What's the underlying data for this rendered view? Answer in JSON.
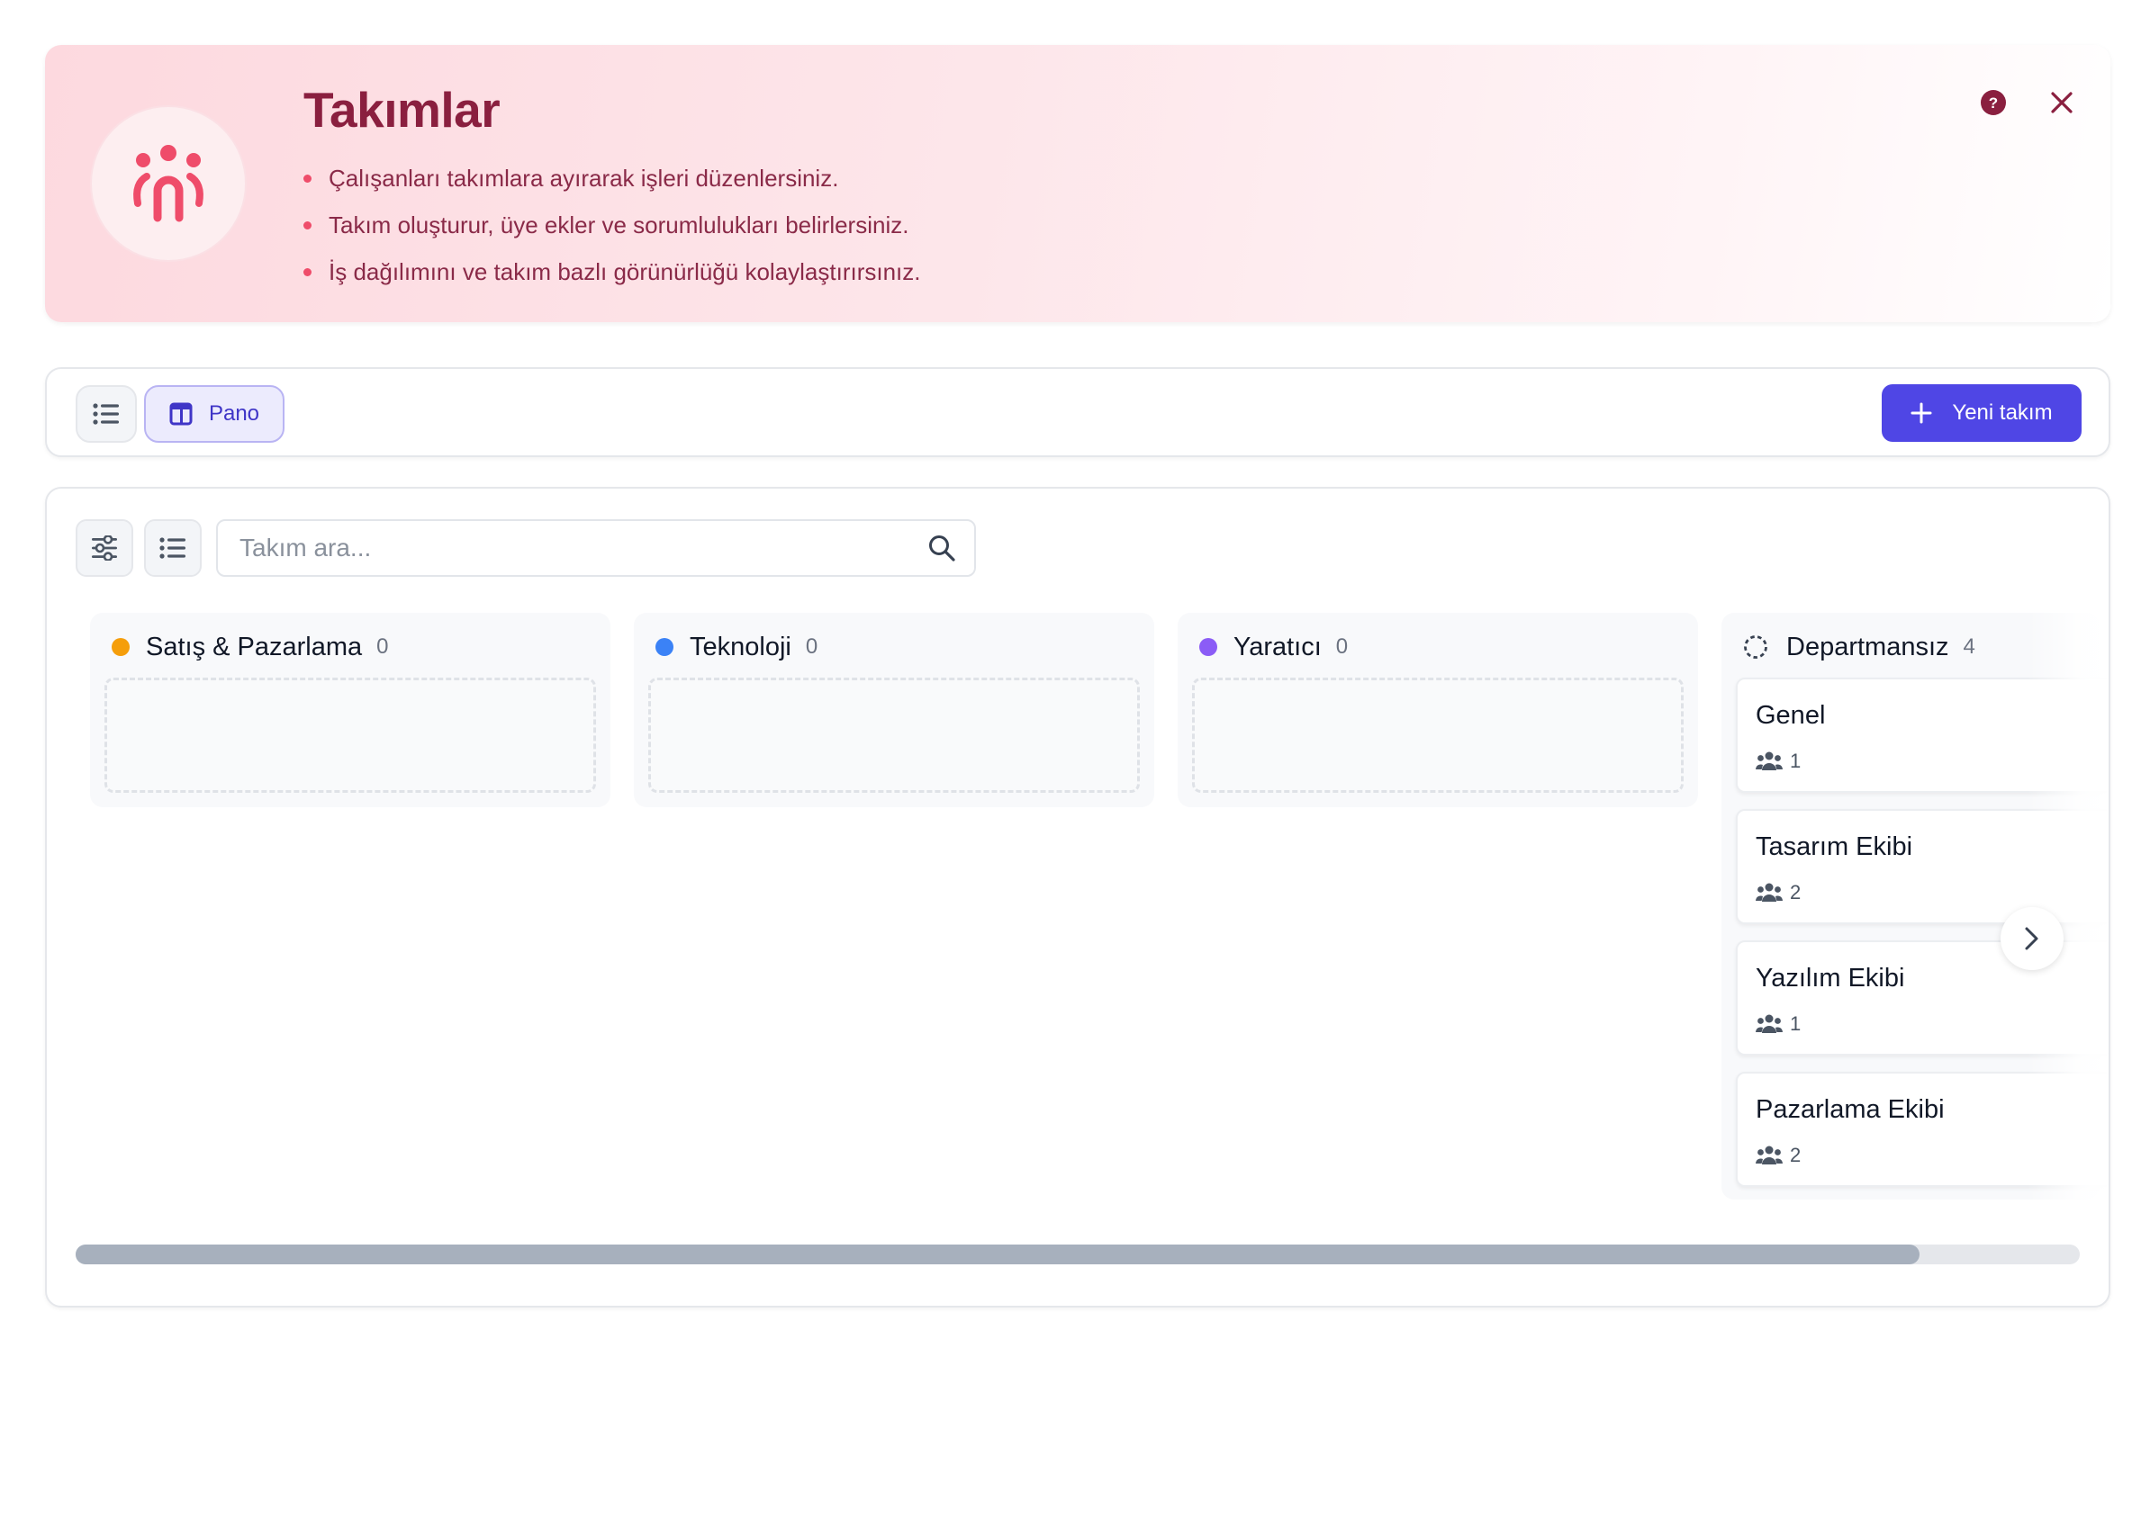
{
  "banner": {
    "title": "Takımlar",
    "bullets": [
      "Çalışanları takımlara ayırarak işleri düzenlersiniz.",
      "Takım oluşturur, üye ekler ve sorumlulukları belirlersiniz.",
      "İş dağılımını ve takım bazlı görünürlüğü kolaylaştırırsınız."
    ],
    "icon": "team-icon",
    "help_icon": "question-circle-icon",
    "close_icon": "close-icon",
    "accent": "#ef4c6a",
    "title_color": "#8a1f3f"
  },
  "toolbar": {
    "list_view_icon": "list-icon",
    "board_view_icon": "board-icon",
    "board_view_label": "Pano",
    "new_team_label": "Yeni takım",
    "new_team_icon": "plus-icon",
    "primary_color": "#4f46e5"
  },
  "search": {
    "placeholder": "Takım ara...",
    "value": ""
  },
  "columns": [
    {
      "name": "Satış & Pazarlama",
      "count": "0",
      "color": "#f59e0b"
    },
    {
      "name": "Teknoloji",
      "count": "0",
      "color": "#3b82f6"
    },
    {
      "name": "Yaratıcı",
      "count": "0",
      "color": "#8b5cf6"
    },
    {
      "name": "Departmansız",
      "count": "4",
      "icon": "dashed-circle-icon",
      "teams": [
        {
          "name": "Genel",
          "members": "1"
        },
        {
          "name": "Tasarım Ekibi",
          "members": "2"
        },
        {
          "name": "Yazılım Ekibi",
          "members": "1"
        },
        {
          "name": "Pazarlama Ekibi",
          "members": "2"
        }
      ]
    }
  ],
  "scroll": {
    "position_fraction": 0.92
  }
}
